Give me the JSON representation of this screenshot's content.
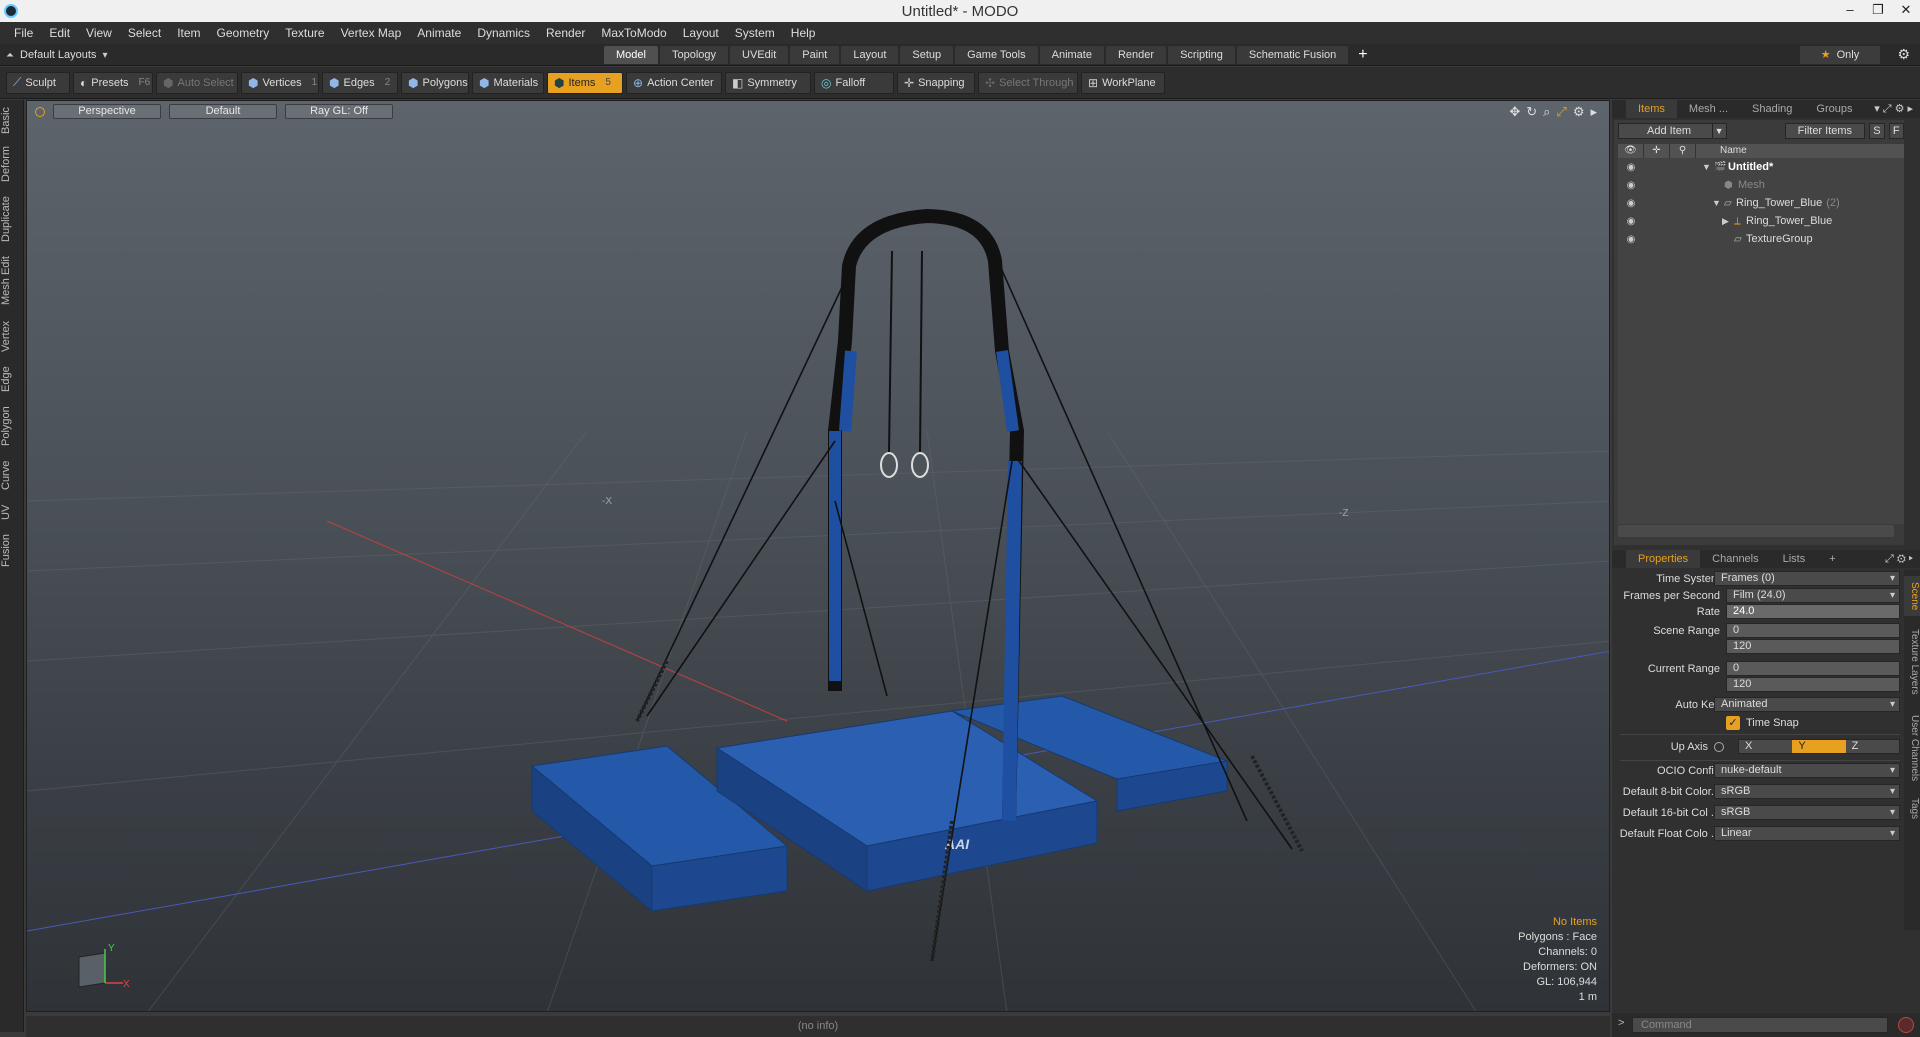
{
  "window": {
    "title": "Untitled* - MODO",
    "minimize": "–",
    "restore": "❐",
    "close": "✕"
  },
  "menu": [
    "File",
    "Edit",
    "View",
    "Select",
    "Item",
    "Geometry",
    "Texture",
    "Vertex Map",
    "Animate",
    "Dynamics",
    "Render",
    "MaxToModo",
    "Layout",
    "System",
    "Help"
  ],
  "layouts": {
    "label": "Default Layouts"
  },
  "tabs": [
    "Model",
    "Topology",
    "UVEdit",
    "Paint",
    "Layout",
    "Setup",
    "Game Tools",
    "Animate",
    "Render",
    "Scripting",
    "Schematic Fusion"
  ],
  "active_tab": "Model",
  "only_label": "Only",
  "toolbar": {
    "sculpt": "Sculpt",
    "presets": "Presets",
    "presets_key": "F6",
    "auto_select": "Auto Select",
    "vertices": "Vertices",
    "vertices_key": "1",
    "edges": "Edges",
    "edges_key": "2",
    "polygons": "Polygons",
    "materials": "Materials",
    "items": "Items",
    "items_key": "5",
    "action_center": "Action Center",
    "symmetry": "Symmetry",
    "falloff": "Falloff",
    "snapping": "Snapping",
    "select_through": "Select Through",
    "workplane": "WorkPlane"
  },
  "left_tabs": [
    "Basic",
    "Deform",
    "Duplicate",
    "Mesh Edit",
    "Vertex",
    "Edge",
    "Polygon",
    "Curve",
    "UV",
    "Fusion"
  ],
  "viewport": {
    "view": "Perspective",
    "shading": "Default",
    "raygl": "Ray GL: Off",
    "axis_labels": {
      "neg_x": "-X",
      "neg_z": "-Z"
    },
    "gizmo": {
      "x": "X",
      "y": "Y"
    },
    "stats": {
      "no_items": "No Items",
      "polygons": "Polygons : Face",
      "channels": "Channels: 0",
      "deformers": "Deformers: ON",
      "gl": "GL: 106,944",
      "unit": "1 m"
    },
    "brand": "AAI"
  },
  "status": "(no info)",
  "items_panel": {
    "tabs": [
      "Items",
      "Mesh ...",
      "Shading",
      "Groups"
    ],
    "add_item": "Add Item",
    "filter": "Filter Items",
    "s": "S",
    "f": "F",
    "header_name": "Name",
    "tree": [
      {
        "label": "Untitled*",
        "level": 0,
        "style": "bold"
      },
      {
        "label": "Mesh",
        "level": 1,
        "style": "dim"
      },
      {
        "label": "Ring_Tower_Blue",
        "level": 1,
        "style": "normal",
        "count": "(2)"
      },
      {
        "label": "Ring_Tower_Blue",
        "level": 2,
        "style": "normal"
      },
      {
        "label": "TextureGroup",
        "level": 2,
        "style": "normal"
      }
    ]
  },
  "props_panel": {
    "tabs": [
      "Properties",
      "Channels",
      "Lists"
    ],
    "time_system": {
      "label": "Time System",
      "value": "Frames (0)"
    },
    "fps": {
      "label": "Frames per Second",
      "value": "Film (24.0)"
    },
    "rate": {
      "label": "Rate",
      "value": "24.0"
    },
    "scene_range": {
      "label": "Scene Range",
      "start": "0",
      "end": "120"
    },
    "current_range": {
      "label": "Current Range",
      "start": "0",
      "end": "120"
    },
    "auto_key": {
      "label": "Auto Key",
      "value": "Animated"
    },
    "time_snap": {
      "label": "Time Snap",
      "checked": true
    },
    "up_axis": {
      "label": "Up Axis",
      "options": [
        "X",
        "Y",
        "Z"
      ],
      "selected": "Y"
    },
    "ocio": {
      "label": "OCIO Config",
      "value": "nuke-default"
    },
    "color8": {
      "label": "Default 8-bit Color...",
      "value": "sRGB"
    },
    "color16": {
      "label": "Default 16-bit Col ...",
      "value": "sRGB"
    },
    "colorfloat": {
      "label": "Default Float Colo ...",
      "value": "Linear"
    }
  },
  "right_vtabs": [
    "Scene",
    "Texture Layers",
    "User Channels",
    "Tags"
  ],
  "command_placeholder": "Command",
  "colors": {
    "accent": "#e8a020",
    "mesh_blue": "#2257a8"
  }
}
